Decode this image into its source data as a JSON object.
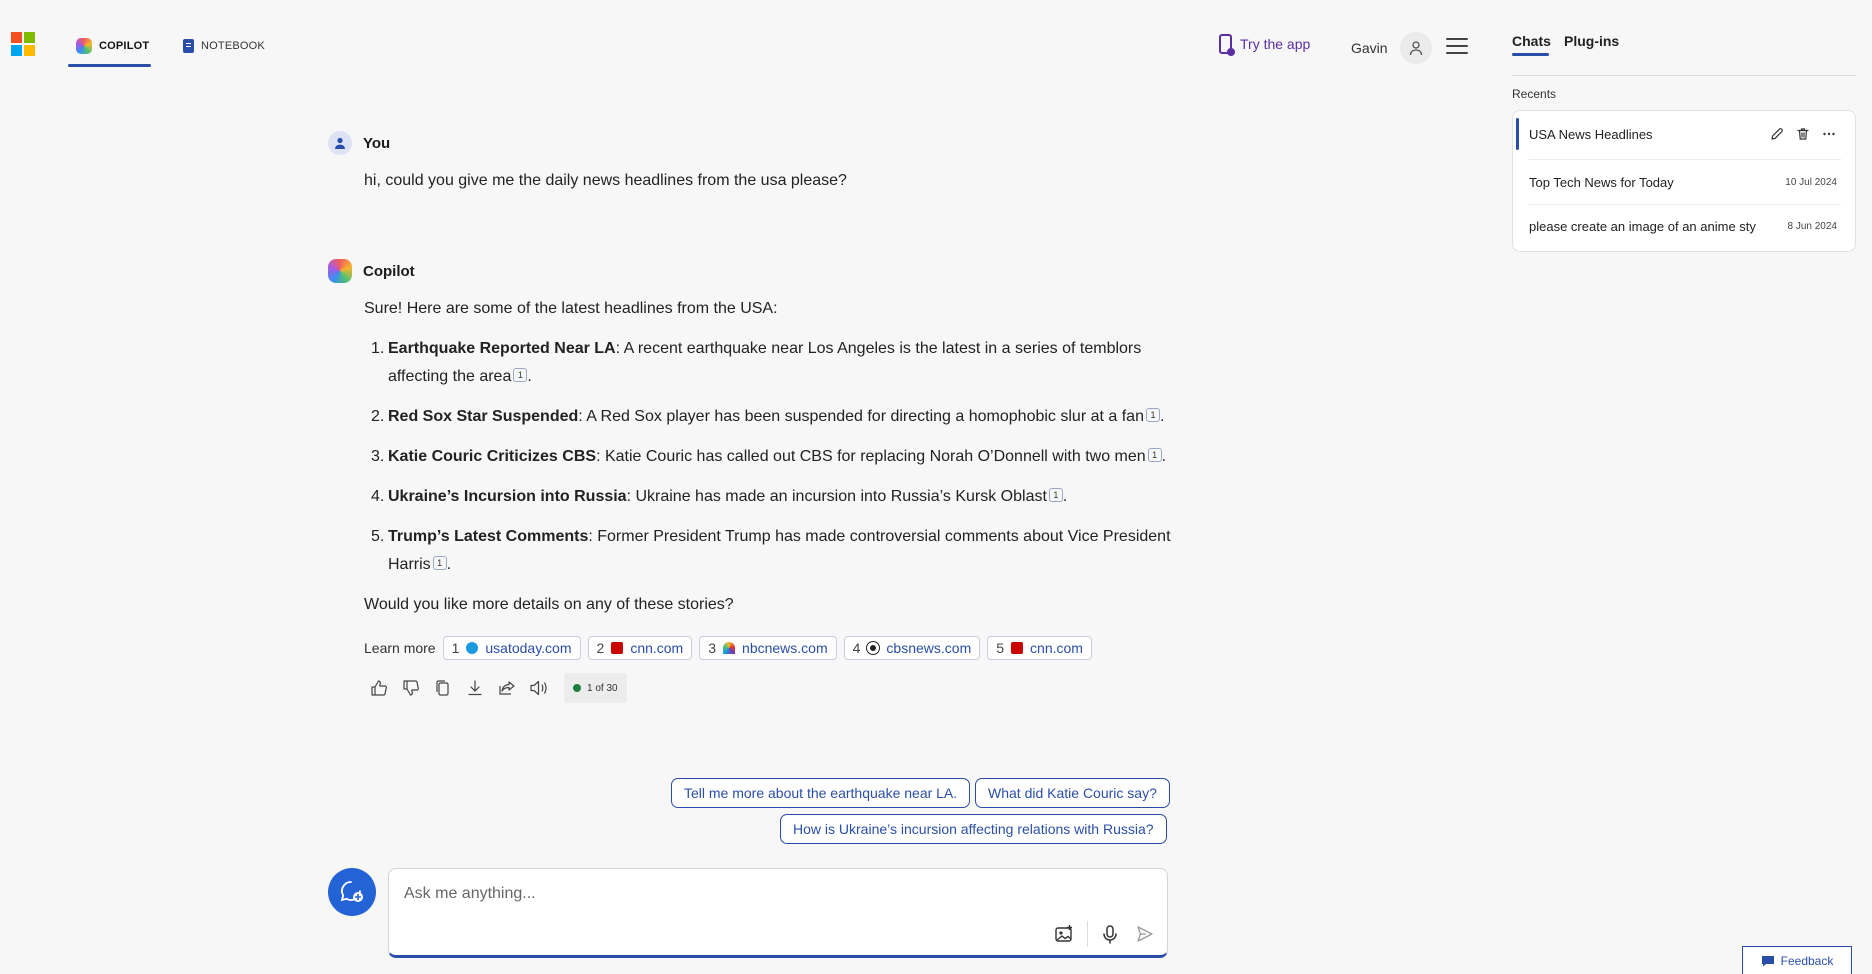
{
  "header": {
    "tabs": [
      {
        "label": "COPILOT",
        "icon": "copilot-logo-icon",
        "active": true
      },
      {
        "label": "NOTEBOOK",
        "icon": "notebook-icon",
        "active": false
      }
    ],
    "try_app_label": "Try the app",
    "user_name": "Gavin"
  },
  "conversation": {
    "user": {
      "name": "You",
      "message": "hi, could you give me the daily news headlines from the usa please?"
    },
    "assistant": {
      "name": "Copilot",
      "intro": "Sure! Here are some of the latest headlines from the USA:",
      "items": [
        {
          "num": "1.",
          "title": "Earthquake Reported Near LA",
          "text": ": A recent earthquake near Los Angeles is the latest in a series of temblors affecting the area",
          "cite": "1"
        },
        {
          "num": "2.",
          "title": "Red Sox Star Suspended",
          "text": ": A Red Sox player has been suspended for directing a homophobic slur at a fan",
          "cite": "1"
        },
        {
          "num": "3.",
          "title": "Katie Couric Criticizes CBS",
          "text": ": Katie Couric has called out CBS for replacing Norah O’Donnell with two men",
          "cite": "1"
        },
        {
          "num": "4.",
          "title": "Ukraine’s Incursion into Russia",
          "text": ": Ukraine has made an incursion into Russia’s Kursk Oblast",
          "cite": "1"
        },
        {
          "num": "5.",
          "title": "Trump’s Latest Comments",
          "text": ": Former President Trump has made controversial comments about Vice President Harris",
          "cite": "1"
        }
      ],
      "outro": "Would you like more details on any of these stories?",
      "learn_more_label": "Learn more",
      "sources": [
        {
          "idx": "1",
          "domain": "usatoday.com",
          "color": "#1b9ae0"
        },
        {
          "idx": "2",
          "domain": "cnn.com",
          "color": "#cc0000"
        },
        {
          "idx": "3",
          "domain": "nbcnews.com",
          "color": "#6e3bb3"
        },
        {
          "idx": "4",
          "domain": "cbsnews.com",
          "color": "#222222"
        },
        {
          "idx": "5",
          "domain": "cnn.com",
          "color": "#cc0000"
        }
      ],
      "response_count": "1 of 30"
    }
  },
  "suggestions": [
    "Tell me more about the earthquake near LA.",
    "What did Katie Couric say?",
    "How is Ukraine’s incursion affecting relations with Russia?"
  ],
  "composer": {
    "placeholder": "Ask me anything..."
  },
  "sidebar": {
    "tabs": [
      "Chats",
      "Plug-ins"
    ],
    "recents_label": "Recents",
    "recents": [
      {
        "title": "USA News Headlines",
        "date": ""
      },
      {
        "title": "Top Tech News for Today",
        "date": "10 Jul 2024"
      },
      {
        "title": "please create an image of an anime sty",
        "date": "8 Jun 2024"
      }
    ]
  },
  "feedback_label": "Feedback",
  "colors": {
    "accent": "#2a4ea8",
    "try_app": "#5b2f9f",
    "background": "#f7f7f7"
  }
}
